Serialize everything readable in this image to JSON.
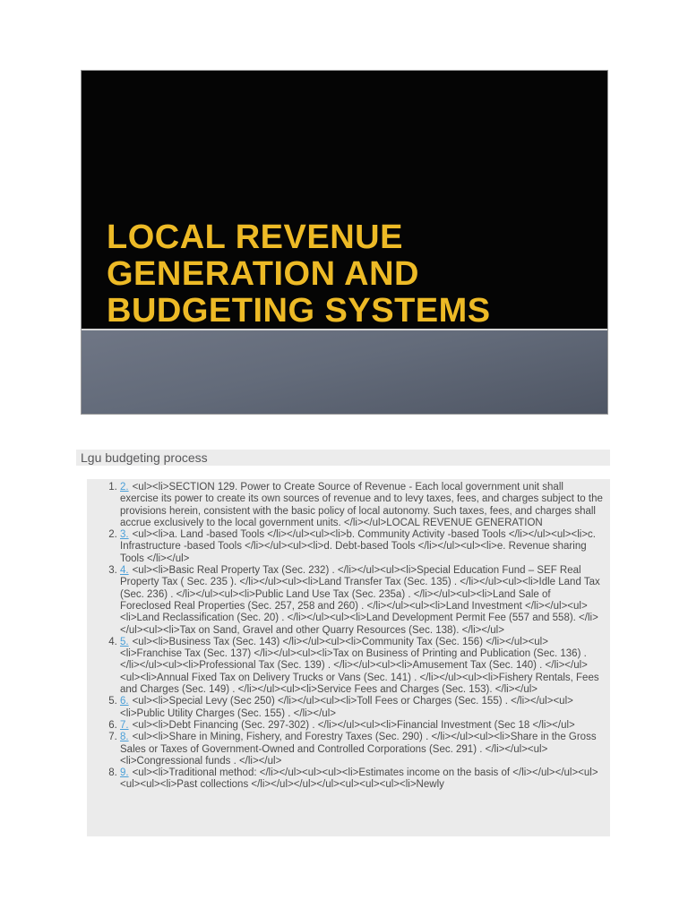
{
  "slide": {
    "title_lines": [
      "LOCAL REVENUE",
      "GENERATION AND",
      "BUDGETING SYSTEMS"
    ]
  },
  "section": {
    "heading": "Lgu budgeting process"
  },
  "list": {
    "items": [
      {
        "link": "2.",
        "text": "<ul><li>SECTION 129. Power to Create Source of Revenue - Each local government unit shall exercise its power to create its own sources of revenue and to levy taxes, fees, and charges subject to the provisions herein, consistent with the basic policy of local autonomy. Such taxes, fees, and charges shall accrue exclusively to the local government units. </li></ul>LOCAL REVENUE GENERATION"
      },
      {
        "link": "3.",
        "text": "<ul><li>a. Land -based Tools </li></ul><ul><li>b. Community Activity -based Tools </li></ul><ul><li>c. Infrastructure -based Tools </li></ul><ul><li>d. Debt-based Tools </li></ul><ul><li>e. Revenue sharing Tools </li></ul>"
      },
      {
        "link": "4.",
        "text": "<ul><li>Basic Real Property Tax (Sec. 232) . </li></ul><ul><li>Special Education Fund – SEF Real Property Tax ( Sec. 235 ). </li></ul><ul><li>Land Transfer Tax (Sec. 135) . </li></ul><ul><li>Idle Land Tax (Sec. 236) . </li></ul><ul><li>Public Land Use Tax (Sec. 235a) . </li></ul><ul><li>Land Sale of Foreclosed Real Properties (Sec. 257, 258 and 260) . </li></ul><ul><li>Land Investment </li></ul><ul><li>Land Reclassification (Sec. 20) . </li></ul><ul><li>Land Development Permit Fee (557 and 558). </li></ul><ul><li>Tax on Sand, Gravel and other Quarry Resources (Sec. 138). </li></ul>"
      },
      {
        "link": "5.",
        "text": "<ul><li>Business Tax (Sec. 143) </li></ul><ul><li>Community Tax (Sec. 156) </li></ul><ul><li>Franchise Tax (Sec. 137) </li></ul><ul><li>Tax on Business of Printing and Publication (Sec. 136) . </li></ul><ul><li>Professional Tax (Sec. 139) . </li></ul><ul><li>Amusement Tax (Sec. 140) . </li></ul><ul><li>Annual Fixed Tax on Delivery Trucks or Vans (Sec. 141) . </li></ul><ul><li>Fishery Rentals, Fees and Charges (Sec. 149) . </li></ul><ul><li>Service Fees and Charges (Sec. 153). </li></ul>"
      },
      {
        "link": "6.",
        "text": "<ul><li>Special Levy (Sec 250) </li></ul><ul><li>Toll Fees or Charges (Sec. 155) . </li></ul><ul><li>Public Utility Charges (Sec. 155) . </li></ul>"
      },
      {
        "link": "7.",
        "text": "<ul><li>Debt Financing (Sec. 297-302) . </li></ul><ul><li>Financial Investment (Sec 18 </li></ul>"
      },
      {
        "link": "8.",
        "text": "<ul><li>Share in Mining, Fishery, and Forestry Taxes (Sec. 290) . </li></ul><ul><li>Share in the Gross Sales or Taxes of Government-Owned and Controlled Corporations (Sec. 291) . </li></ul><ul><li>Congressional funds . </li></ul>"
      },
      {
        "link": "9.",
        "text": "<ul><li>Traditional method: </li></ul><ul><ul><li>Estimates income on the basis of </li></ul></ul><ul><ul><ul><li>Past collections </li></ul></ul></ul><ul><ul><ul><li>Newly"
      }
    ]
  },
  "colors": {
    "link": "#4b9fd8",
    "body_text": "#4a4a4a",
    "slide_title": "#edba26",
    "panel_bg": "#ebebeb",
    "heading_bg": "#ececec",
    "heading_text": "#58585a",
    "band_top": "#6f7685",
    "band_bottom": "#4f5664",
    "slide_bg": "#050505"
  }
}
